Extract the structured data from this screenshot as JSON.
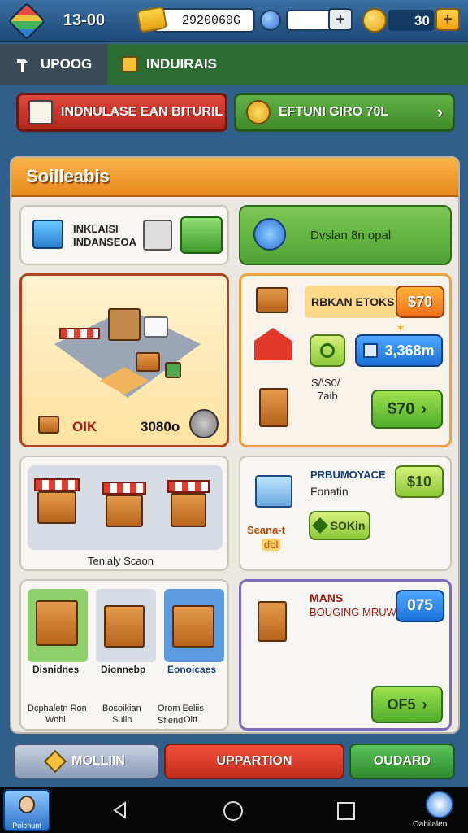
{
  "hud": {
    "level": "13-00",
    "coins": "2920060G",
    "gems": "30"
  },
  "tabs": [
    {
      "label": "UPOOG"
    },
    {
      "label": "INDUIRAIS"
    }
  ],
  "banners": {
    "left": "INDNULASE EAN BITURIL",
    "right": "EFTUNI GIRO 70L"
  },
  "panel": {
    "title": "Soilleabis"
  },
  "cards": {
    "info_card": {
      "line1": "INKLAISI",
      "line2": "INDANSEOA"
    },
    "green_card": {
      "label": "Dvslan 8n opal"
    },
    "room_card": {
      "tag": "OIK",
      "value": "3080o"
    },
    "stocks_card": {
      "title": "RBKAN ETOKS",
      "price_top": "$70",
      "amount": "3,368m",
      "note1": "S/\\S0/",
      "note2": "7aib",
      "buy_label": "$70"
    },
    "shops_card": {
      "caption": "Tenlaly Scaon"
    },
    "procurement_card": {
      "title": "PRBUMOYACE",
      "subtitle": "Fonatin",
      "price": "$10",
      "side_label": "Seana-t",
      "side_sub": "dbl",
      "sokin": "SOKin"
    },
    "choices": [
      {
        "badge": "Disnidnes",
        "caption1": "Dcphaletn Ron",
        "caption2": "Wohi"
      },
      {
        "badge": "Dionnebp",
        "caption1": "Bosoikian",
        "caption2": "Suiln"
      },
      {
        "badge": "Eonoicaes",
        "caption1": "Orom Eeliis Sfiend",
        "caption2": "Oltt"
      }
    ],
    "mans_card": {
      "title": "MANS",
      "subtitle": "BOUGING MRUW",
      "counter": "075",
      "action": "OF5"
    }
  },
  "bottom_buttons": {
    "left": "MOLLIIN",
    "middle": "UPPARTION",
    "right": "OUDARD"
  },
  "nav": {
    "avatar_label": "Polehunt",
    "corner_label": "Oahilalen"
  },
  "colors": {
    "accent_orange": "#ea8a1f",
    "accent_green": "#4fae2a",
    "accent_red": "#c7342a",
    "accent_blue": "#1d6fd8"
  }
}
